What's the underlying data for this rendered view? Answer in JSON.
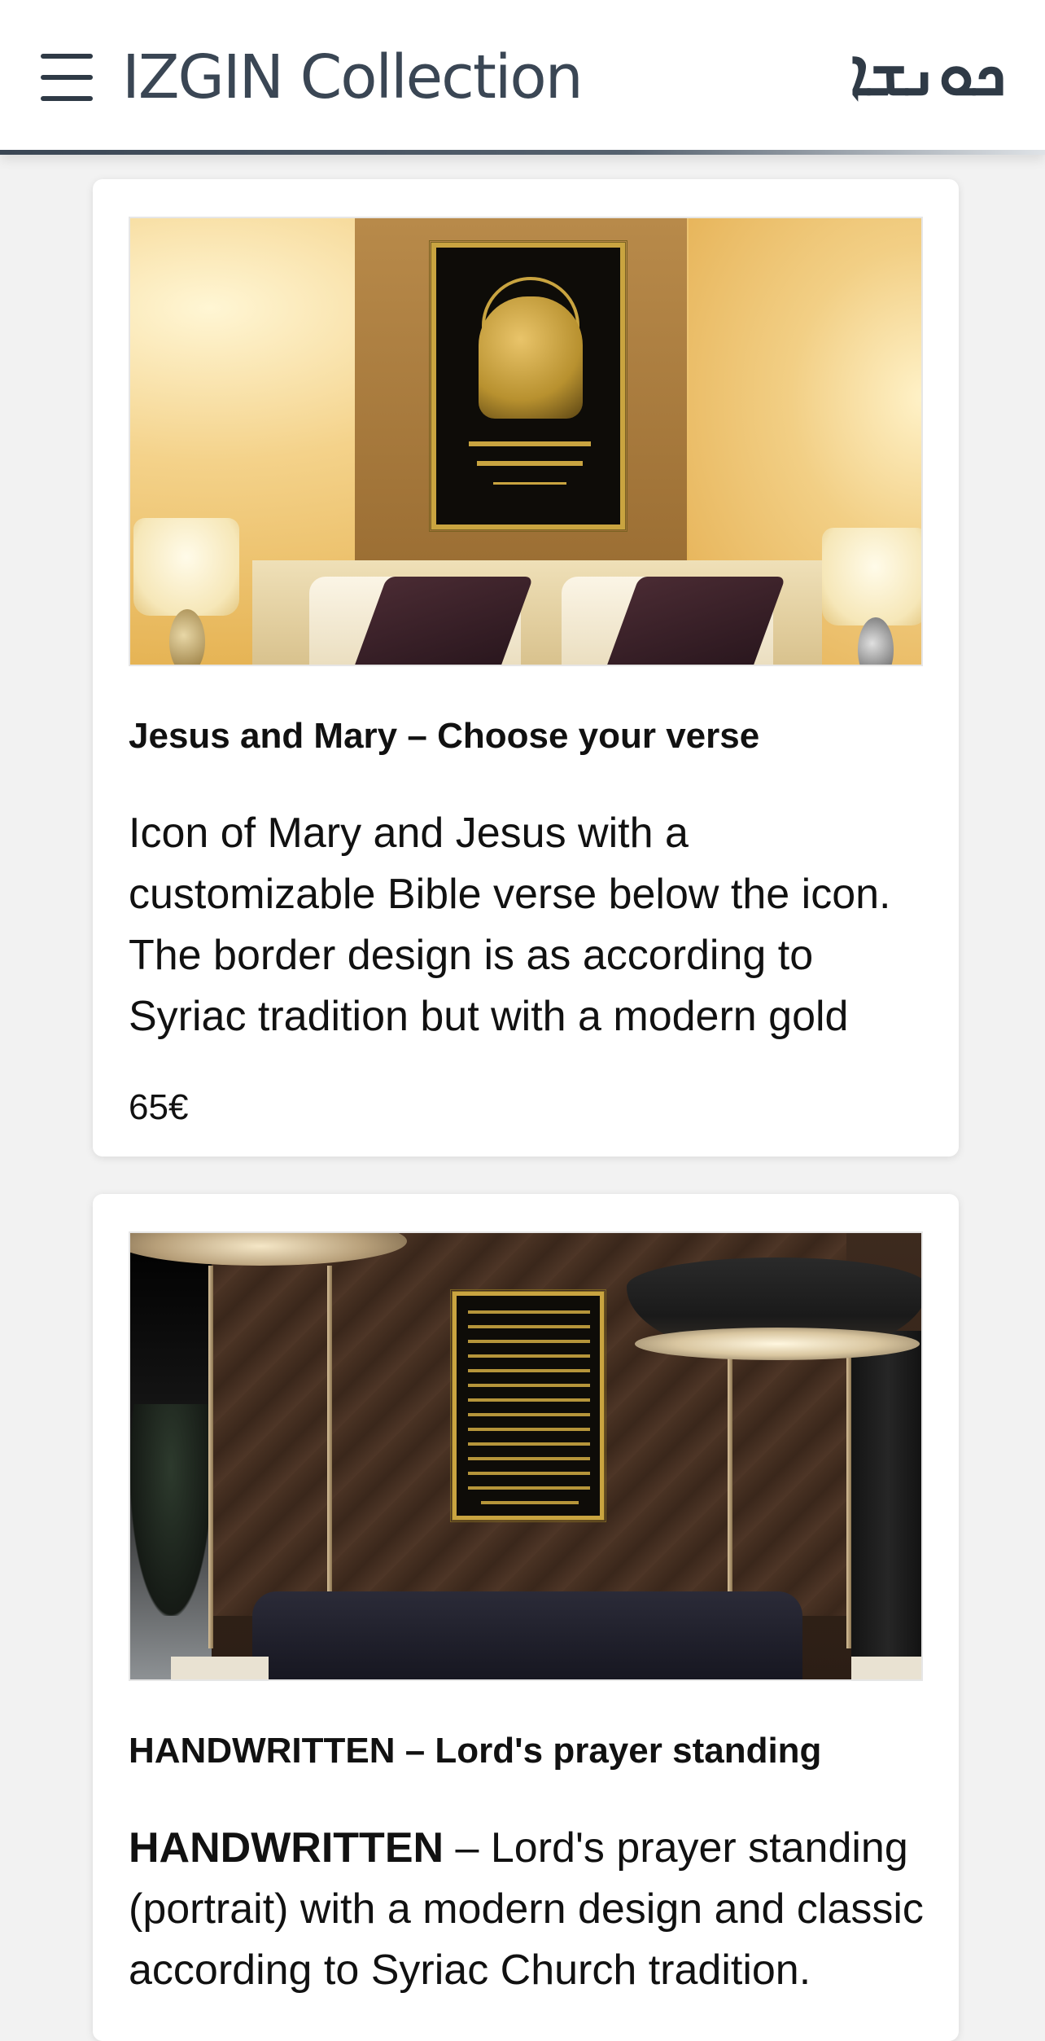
{
  "header": {
    "brand_name": "IZGIN Collection",
    "brand_syriac": "ܟܘܢܫܐ",
    "menu_icon": "hamburger-menu-icon",
    "colors": {
      "brand_text": "#3a4654",
      "background": "#ffffff"
    }
  },
  "products": [
    {
      "title": "Jesus and Mary – Choose your verse",
      "description": "Icon of Mary and Jesus with a customizable Bible verse below the icon. The border design is as according to Syriac tradition but with a modern gold",
      "price": "65€"
    },
    {
      "title": "HANDWRITTEN – Lord's prayer standing",
      "description_bold": "HANDWRITTEN",
      "description_rest": " – Lord's prayer standing (portrait) with a modern design and classic according to Syriac Church tradition."
    }
  ]
}
